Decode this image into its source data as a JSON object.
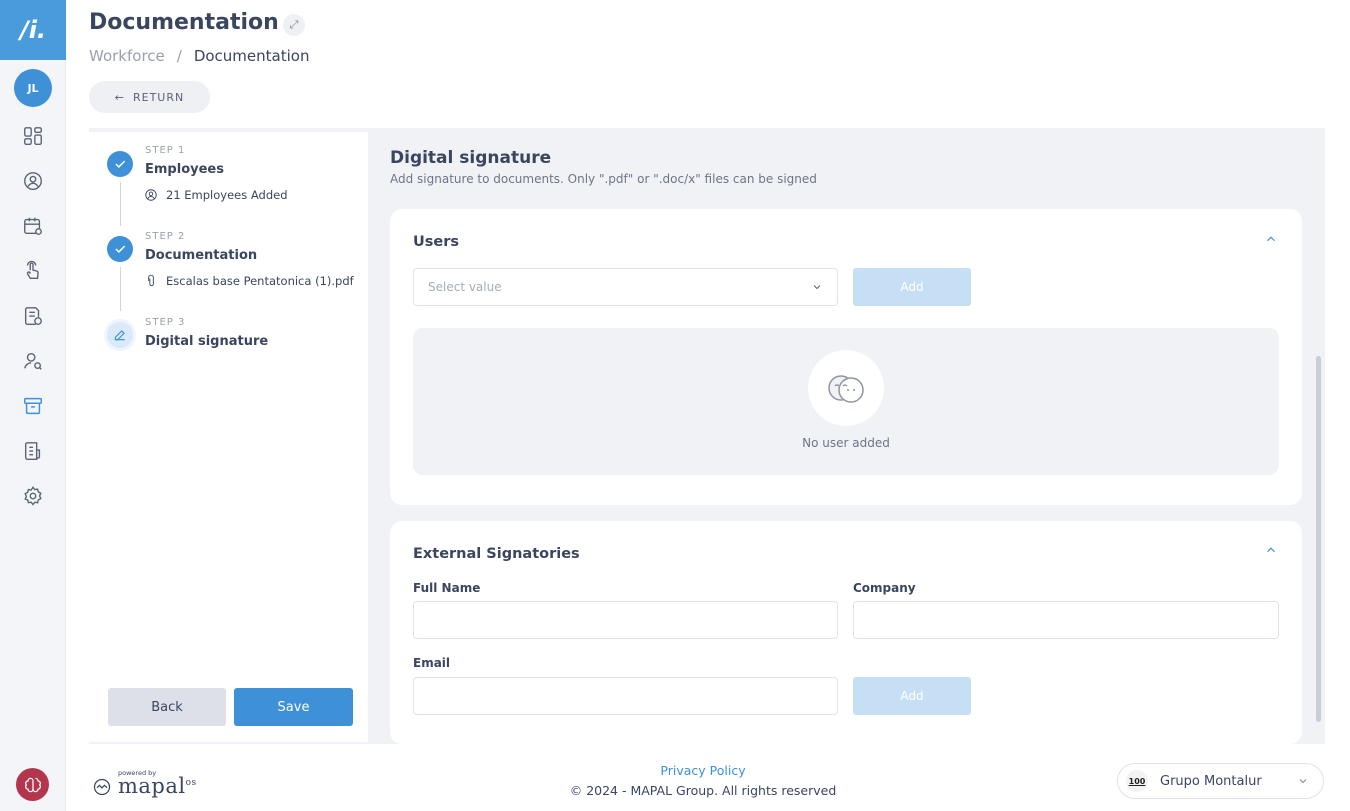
{
  "rail": {
    "logo": "/i.",
    "avatar_initials": "JL",
    "items": [
      {
        "name": "dashboard-icon"
      },
      {
        "name": "user-circle-icon"
      },
      {
        "name": "calendar-icon"
      },
      {
        "name": "touch-icon"
      },
      {
        "name": "document-clock-icon"
      },
      {
        "name": "user-search-icon"
      },
      {
        "name": "archive-icon"
      },
      {
        "name": "report-icon"
      },
      {
        "name": "gear-icon"
      }
    ]
  },
  "header": {
    "title": "Documentation",
    "breadcrumb": [
      "Workforce",
      "Documentation"
    ],
    "return_label": "RETURN"
  },
  "steps": [
    {
      "kicker": "STEP 1",
      "title": "Employees",
      "detail": "21 Employees Added",
      "status": "done",
      "detail_icon": "user-circle-icon"
    },
    {
      "kicker": "STEP 2",
      "title": "Documentation",
      "detail": "Escalas base Pentatonica (1).pdf",
      "status": "done",
      "detail_icon": "paperclip-icon"
    },
    {
      "kicker": "STEP 3",
      "title": "Digital signature",
      "status": "current"
    }
  ],
  "actions": {
    "back": "Back",
    "save": "Save"
  },
  "main": {
    "title": "Digital signature",
    "subtitle": "Add signature to documents. Only \".pdf\" or \".doc/x\" files can be signed",
    "users": {
      "title": "Users",
      "select_placeholder": "Select value",
      "add_label": "Add",
      "empty_text": "No user added"
    },
    "external": {
      "title": "External Signatories",
      "full_name_label": "Full Name",
      "company_label": "Company",
      "email_label": "Email",
      "add_label": "Add"
    }
  },
  "footer": {
    "powered_by": "powered by",
    "brand": "mapal",
    "brand_suffix": "os",
    "privacy": "Privacy Policy",
    "copyright": "© 2024 - MAPAL Group. All rights reserved",
    "company_logo": "100",
    "company": "Grupo Montalur"
  },
  "colors": {
    "accent": "#3e91d6",
    "rail_logo_bg": "#4a9bdc",
    "disabled_button": "#c7dff4",
    "bottom_badge": "#b3364d"
  }
}
